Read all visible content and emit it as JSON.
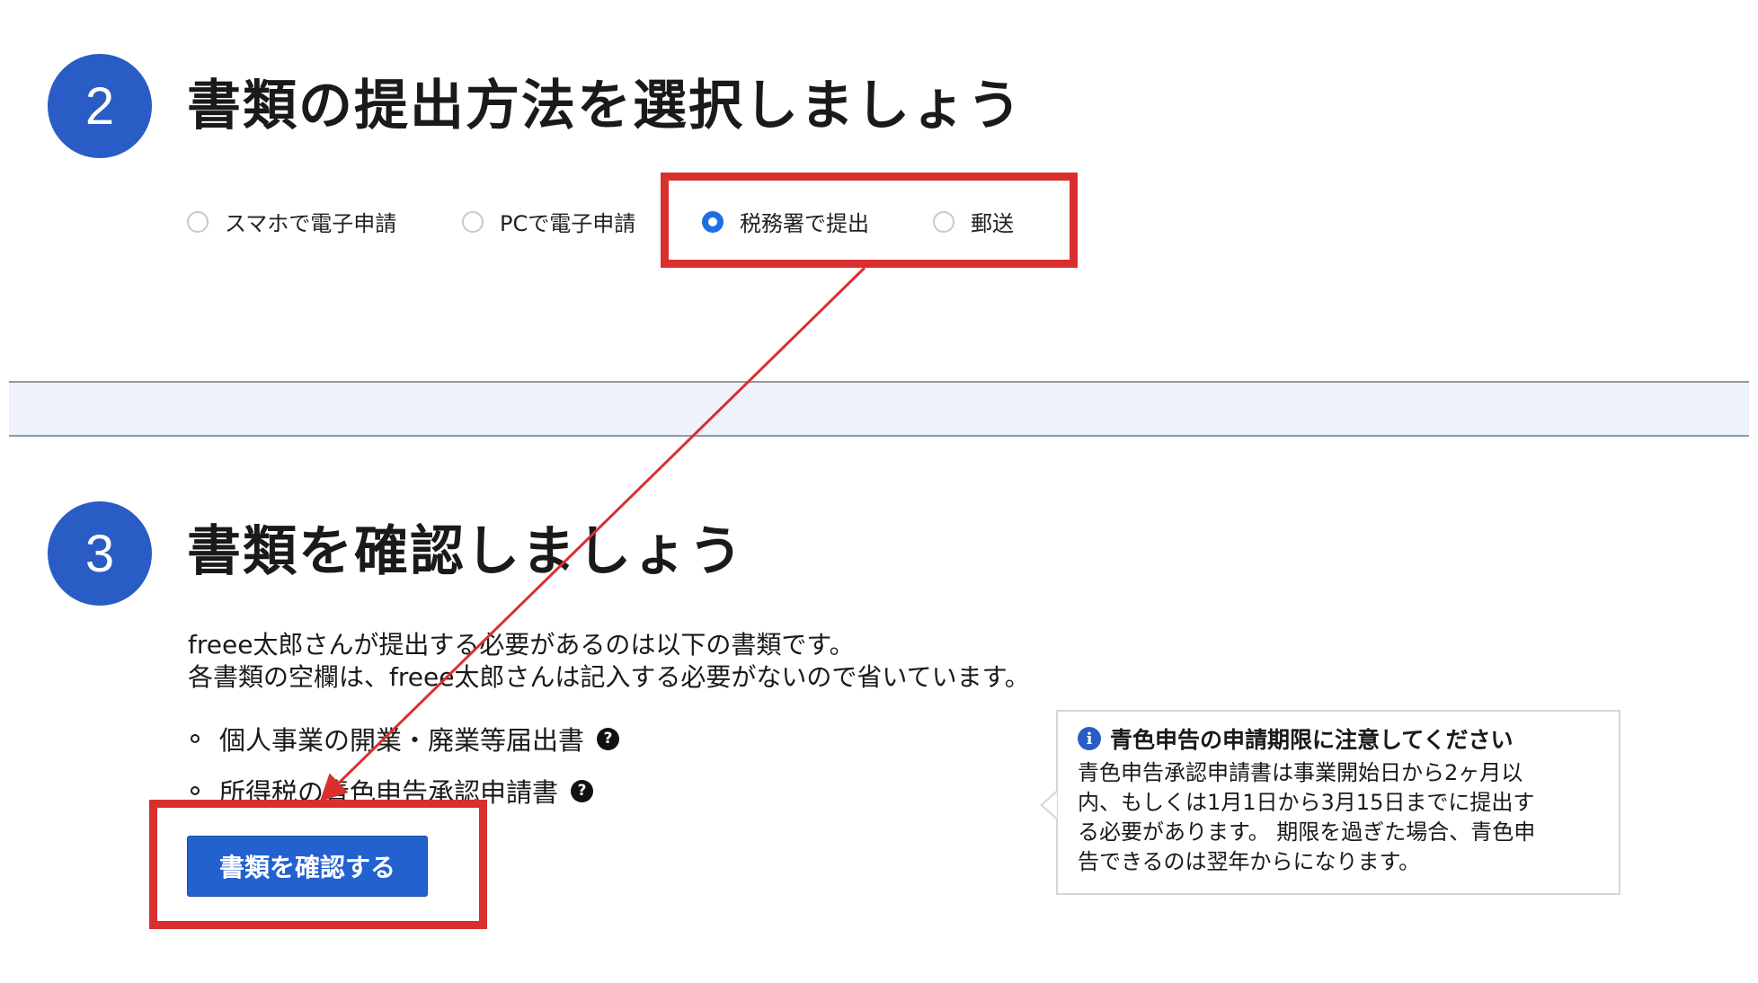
{
  "step2": {
    "number": "2",
    "title": "書類の提出方法を選択しましょう",
    "options": [
      {
        "label": "スマホで電子申請",
        "checked": false
      },
      {
        "label": "PCで電子申請",
        "checked": false
      },
      {
        "label": "税務署で提出",
        "checked": true
      },
      {
        "label": "郵送",
        "checked": false
      }
    ]
  },
  "step3": {
    "number": "3",
    "title": "書類を確認しましょう",
    "description_line1": "freee太郎さんが提出する必要があるのは以下の書類です。",
    "description_line2": "各書類の空欄は、freee太郎さんは記入する必要がないので省いています。",
    "documents": [
      {
        "label": "個人事業の開業・廃業等届出書"
      },
      {
        "label": "所得税の青色申告承認申請書"
      }
    ],
    "confirm_button_label": "書類を確認する"
  },
  "info_box": {
    "icon_glyph": "i",
    "title": "青色申告の申請期限に注意してください",
    "body": "青色申告承認申請書は事業開始日から2ヶ月以\n内、もしくは1月1日から3月15日までに提出す\nる必要があります。 期限を過ぎた場合、青色申\n告できるのは翌年からになります。"
  },
  "help_icon_glyph": "?",
  "colors": {
    "step_circle": "#2a5cc6",
    "radio_checked": "#1e6fe6",
    "button": "#2361cf",
    "highlight": "#d9302f",
    "divider_band": "#edf2fb"
  }
}
